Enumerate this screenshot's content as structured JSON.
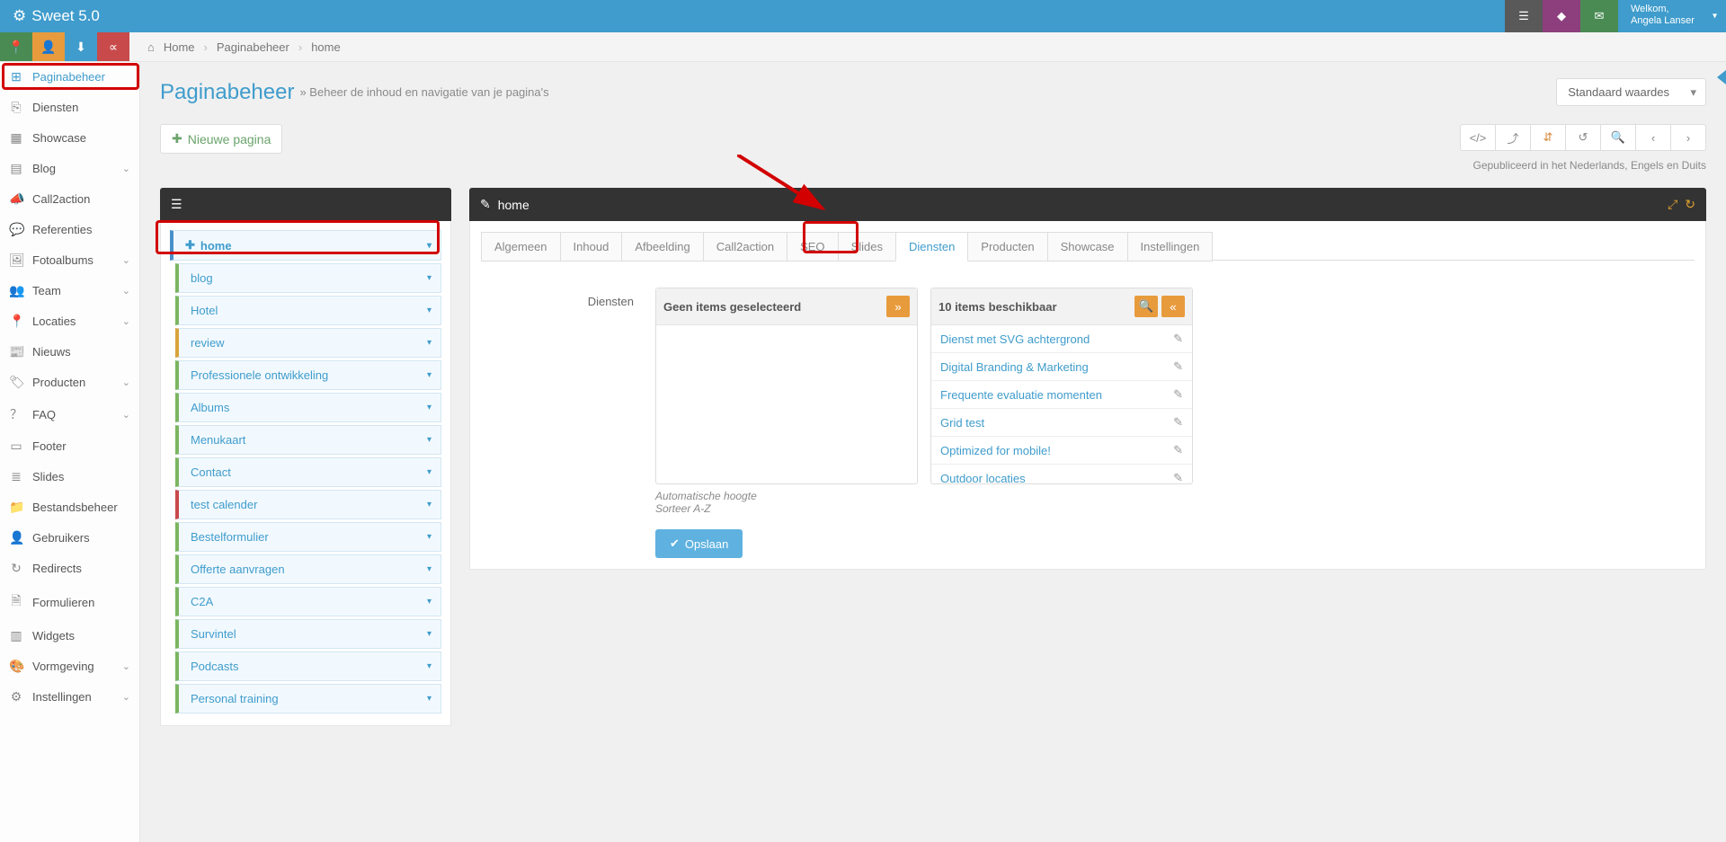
{
  "brand": "Sweet 5.0",
  "welcome": {
    "line1": "Welkom,",
    "line2": "Angela Lanser"
  },
  "breadcrumb": {
    "home": "Home",
    "section": "Paginabeheer",
    "page": "home"
  },
  "sidebar": [
    {
      "label": "Paginabeheer",
      "icon": "⊞",
      "active": true
    },
    {
      "label": "Diensten",
      "icon": "⎘"
    },
    {
      "label": "Showcase",
      "icon": "▦"
    },
    {
      "label": "Blog",
      "icon": "▤",
      "chev": true
    },
    {
      "label": "Call2action",
      "icon": "📣"
    },
    {
      "label": "Referenties",
      "icon": "💬"
    },
    {
      "label": "Fotoalbums",
      "icon": "🖼",
      "chev": true
    },
    {
      "label": "Team",
      "icon": "👥",
      "chev": true
    },
    {
      "label": "Locaties",
      "icon": "📍",
      "chev": true
    },
    {
      "label": "Nieuws",
      "icon": "📰"
    },
    {
      "label": "Producten",
      "icon": "🏷",
      "chev": true
    },
    {
      "label": "FAQ",
      "icon": "？",
      "chev": true
    },
    {
      "label": "Footer",
      "icon": "▭"
    },
    {
      "label": "Slides",
      "icon": "≣"
    },
    {
      "label": "Bestandsbeheer",
      "icon": "📁"
    },
    {
      "label": "Gebruikers",
      "icon": "👤"
    },
    {
      "label": "Redirects",
      "icon": "↻"
    },
    {
      "label": "Formulieren",
      "icon": "🗎"
    },
    {
      "label": "Widgets",
      "icon": "▥"
    },
    {
      "label": "Vormgeving",
      "icon": "🎨",
      "chev": true
    },
    {
      "label": "Instellingen",
      "icon": "⚙",
      "chev": true
    }
  ],
  "page": {
    "title": "Paginabeheer",
    "subtitle": "» Beheer de inhoud en navigatie van je pagina's",
    "default_values": "Standaard waardes",
    "new_page": "Nieuwe pagina",
    "pub_note": "Gepubliceerd in het Nederlands, Engels en Duits"
  },
  "tree": {
    "title": "home",
    "home_label": "home",
    "items": [
      {
        "label": "blog",
        "cls": "bl-green"
      },
      {
        "label": "Hotel",
        "cls": "bl-green"
      },
      {
        "label": "review",
        "cls": "bl-orange"
      },
      {
        "label": "Professionele ontwikkeling",
        "cls": "bl-green"
      },
      {
        "label": "Albums",
        "cls": "bl-green"
      },
      {
        "label": "Menukaart",
        "cls": "bl-green"
      },
      {
        "label": "Contact",
        "cls": "bl-green"
      },
      {
        "label": "test calender",
        "cls": "bl-red"
      },
      {
        "label": "Bestelformulier",
        "cls": "bl-green"
      },
      {
        "label": "Offerte aanvragen",
        "cls": "bl-green"
      },
      {
        "label": "C2A",
        "cls": "bl-green"
      },
      {
        "label": "Survintel",
        "cls": "bl-green"
      },
      {
        "label": "Podcasts",
        "cls": "bl-green"
      },
      {
        "label": "Personal training",
        "cls": "bl-green"
      }
    ]
  },
  "editor": {
    "title": "home",
    "tabs": [
      "Algemeen",
      "Inhoud",
      "Afbeelding",
      "Call2action",
      "SEO",
      "Slides",
      "Diensten",
      "Producten",
      "Showcase",
      "Instellingen"
    ],
    "active_tab": 6,
    "field_label": "Diensten",
    "left_header": "Geen items geselecteerd",
    "right_header": "10 items beschikbaar",
    "availables": [
      "Dienst met SVG achtergrond",
      "Digital Branding & Marketing",
      "Frequente evaluatie momenten",
      "Grid test",
      "Optimized for mobile!",
      "Outdoor locaties"
    ],
    "meta1": "Automatische hoogte",
    "meta2": "Sorteer A-Z",
    "save": "Opslaan"
  }
}
